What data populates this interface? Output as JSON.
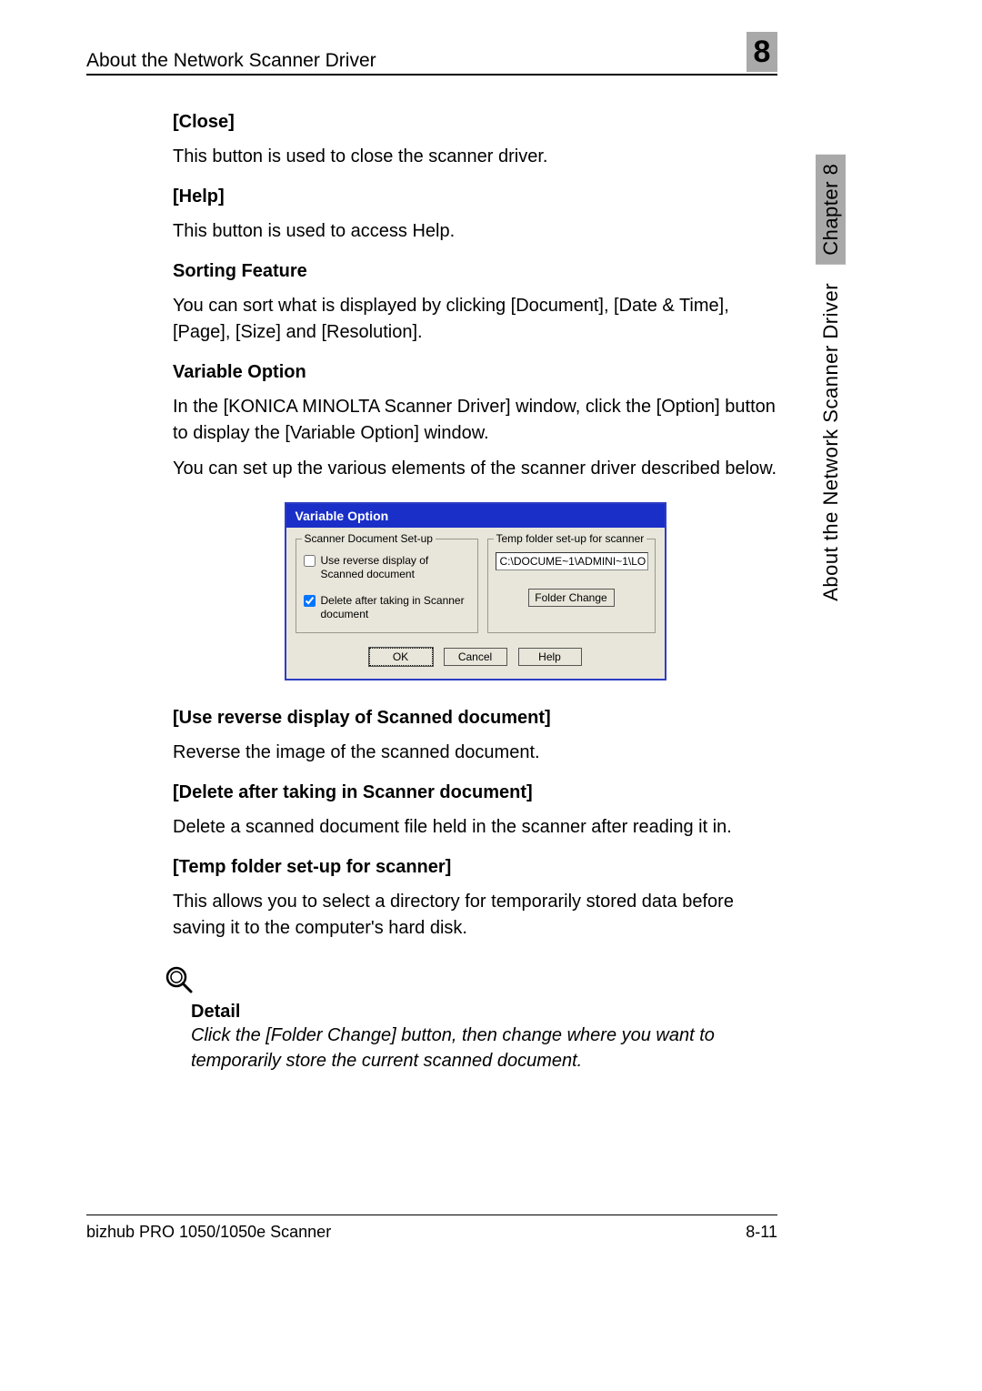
{
  "header": {
    "title": "About the Network Scanner Driver",
    "chapter_number": "8"
  },
  "sections": {
    "close": {
      "h": "[Close]",
      "p": "This button is used to close the scanner driver."
    },
    "help": {
      "h": "[Help]",
      "p": "This button is used to access Help."
    },
    "sorting": {
      "h": "Sorting Feature",
      "p": "You can sort what is displayed by clicking [Document], [Date & Time], [Page], [Size] and [Resolution]."
    },
    "variable": {
      "h": "Variable Option",
      "p1": "In the [KONICA MINOLTA Scanner Driver] window, click the [Option] button to display the [Variable Option] window.",
      "p2": "You can set up the various elements of the scanner driver described below."
    },
    "reverse": {
      "h": "[Use reverse display of Scanned document]",
      "p": "Reverse the image of the scanned document."
    },
    "delete": {
      "h": "[Delete after taking in Scanner document]",
      "p": "Delete a scanned document file held in the scanner after reading it in."
    },
    "temp": {
      "h": "[Temp folder set-up for scanner]",
      "p": "This allows you to select a directory for temporarily stored data before saving it to the computer's hard disk."
    }
  },
  "dialog": {
    "title": "Variable Option",
    "left_legend": "Scanner Document Set-up",
    "cb1_label": "Use reverse display of Scanned document",
    "cb2_label": "Delete after taking in Scanner document",
    "right_legend": "Temp folder set-up for scanner",
    "path_value": "C:\\DOCUME~1\\ADMINI~1\\LO",
    "folder_change": "Folder Change",
    "ok": "OK",
    "cancel": "Cancel",
    "help": "Help"
  },
  "detail": {
    "label": "Detail",
    "text": "Click the [Folder Change] button, then change where you want to temporarily store the current scanned document."
  },
  "footer": {
    "left": "bizhub PRO 1050/1050e Scanner",
    "right": "8-11"
  },
  "side": {
    "section": "About the Network Scanner Driver",
    "chapter": "Chapter 8"
  }
}
